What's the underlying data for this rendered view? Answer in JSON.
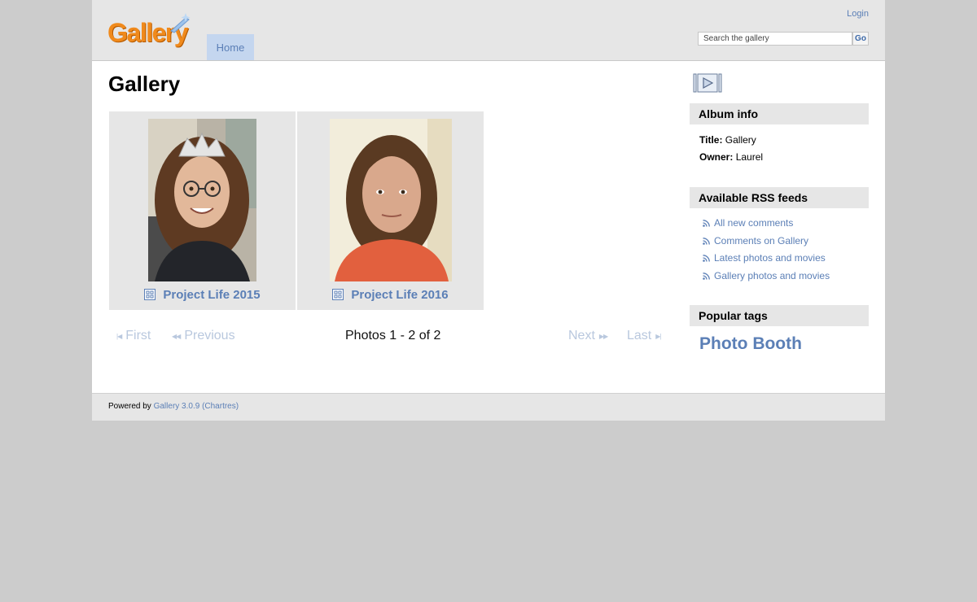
{
  "header": {
    "logo_text": "Gallery",
    "login_label": "Login",
    "nav": [
      {
        "label": "Home"
      }
    ],
    "search": {
      "placeholder": "Search the gallery",
      "go_label": "Go"
    }
  },
  "main": {
    "title": "Gallery",
    "albums": [
      {
        "title": "Project Life 2015"
      },
      {
        "title": "Project Life 2016"
      }
    ],
    "pager": {
      "first": "First",
      "previous": "Previous",
      "info": "Photos 1 - 2 of 2",
      "next": "Next",
      "last": "Last"
    }
  },
  "sidebar": {
    "album_info": {
      "heading": "Album info",
      "title_label": "Title:",
      "title_value": "Gallery",
      "owner_label": "Owner:",
      "owner_value": "Laurel"
    },
    "rss": {
      "heading": "Available RSS feeds",
      "items": [
        {
          "label": "All new comments"
        },
        {
          "label": "Comments on Gallery"
        },
        {
          "label": "Latest photos and movies"
        },
        {
          "label": "Gallery photos and movies"
        }
      ]
    },
    "tags": {
      "heading": "Popular tags",
      "items": [
        {
          "label": "Photo Booth"
        }
      ]
    }
  },
  "footer": {
    "powered_by": "Powered by",
    "link": "Gallery 3.0.9 (Chartres)"
  },
  "colors": {
    "link": "#5b7fb6",
    "logo_orange": "#f08a1c",
    "panel_gray": "#e6e6e6",
    "nav_active": "#c4d6ef",
    "page_bg": "#cccccc"
  }
}
